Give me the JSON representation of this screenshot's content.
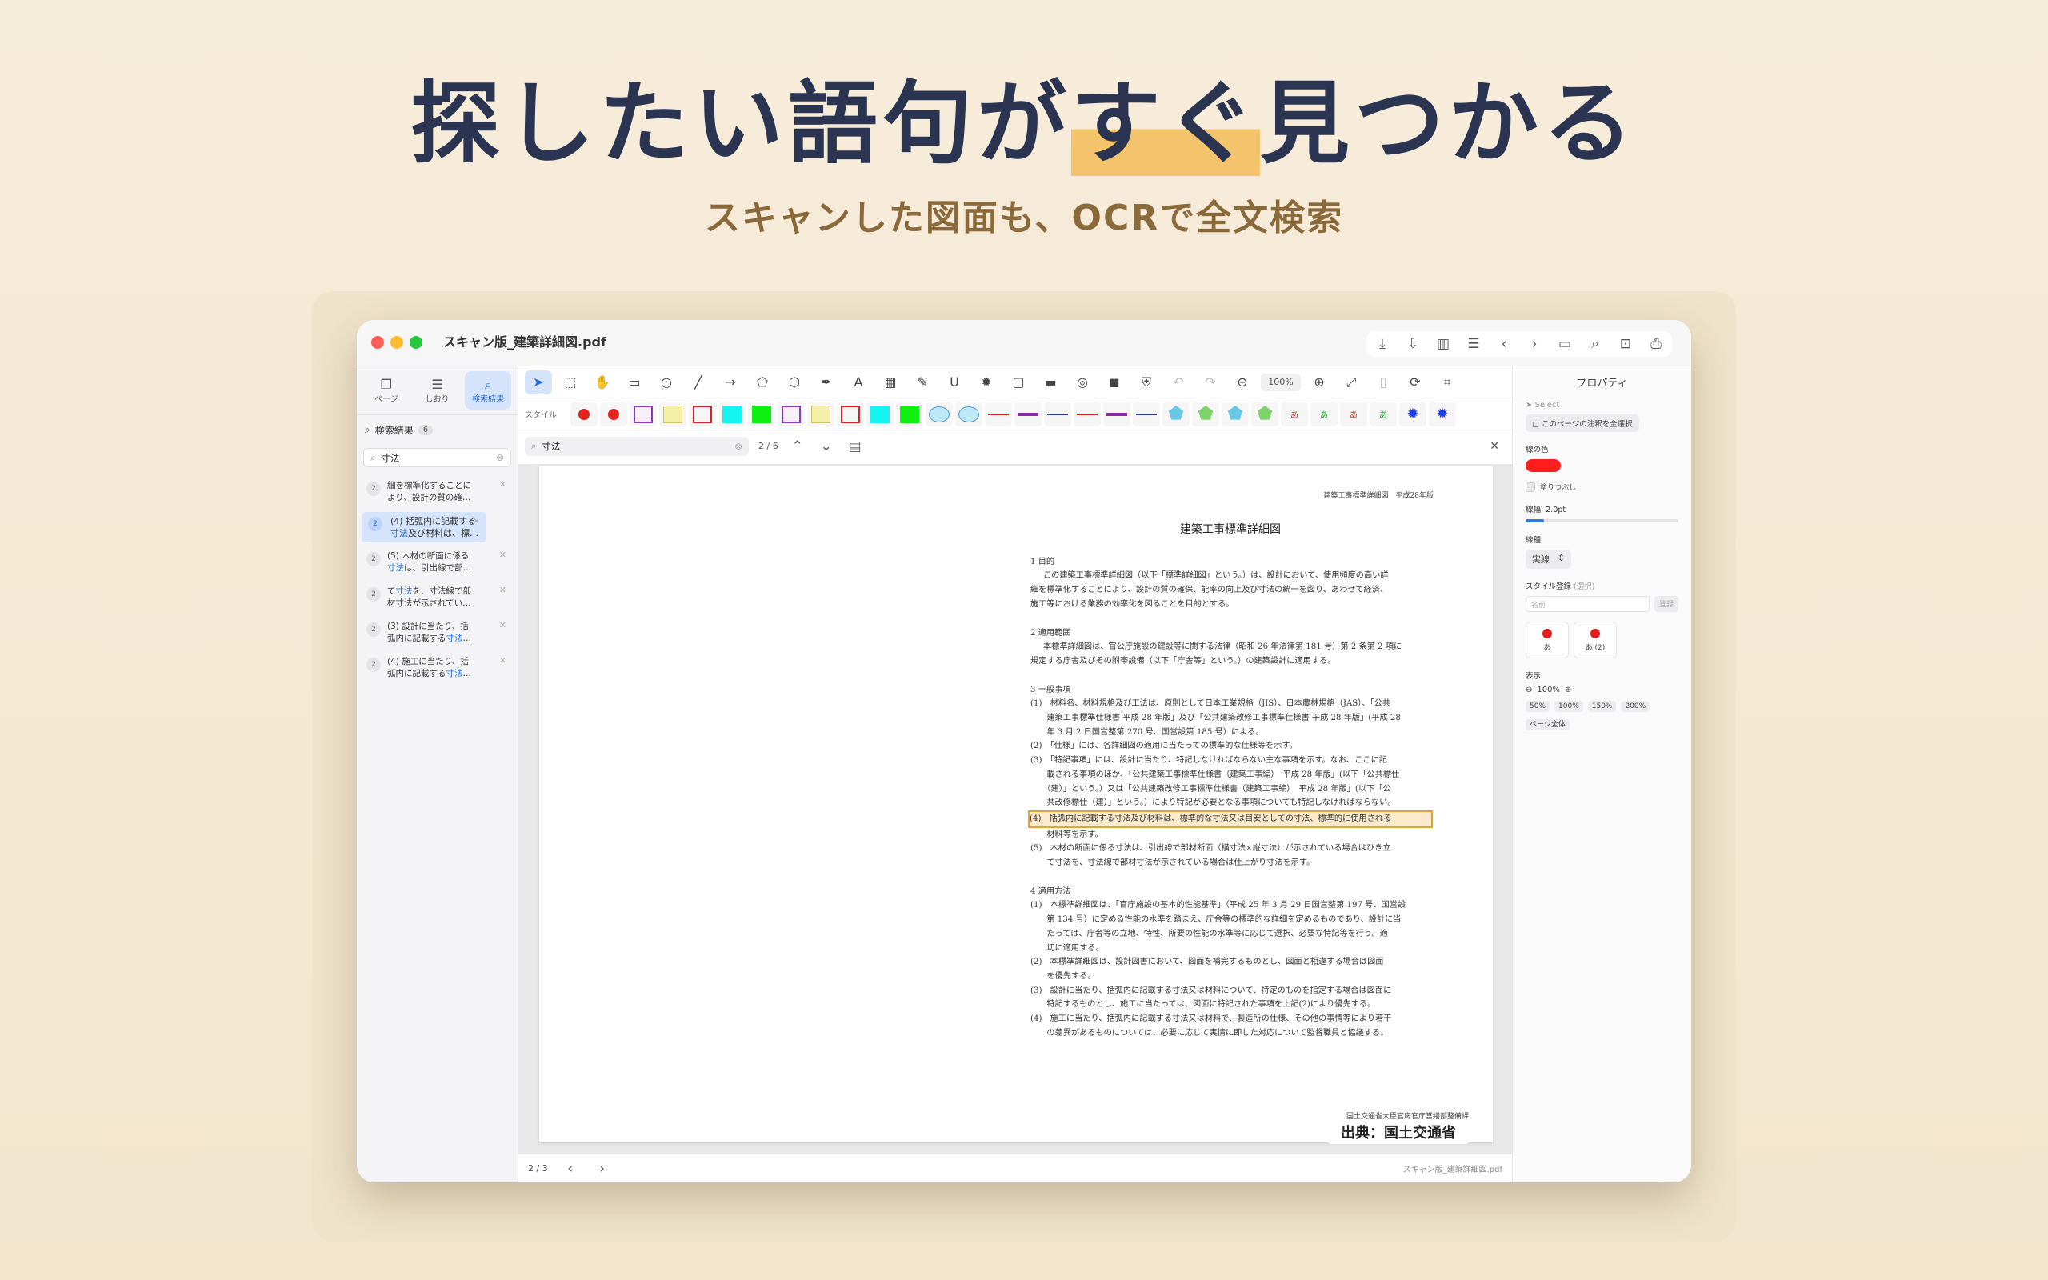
{
  "hero": {
    "title_pre": "探したい語句が",
    "title_highlight": "すぐ",
    "title_post": "見つかる",
    "subtitle": "スキャンした図面も、OCRで全文検索"
  },
  "window": {
    "title": "スキャン版_建築詳細図.pdf"
  },
  "sidebar": {
    "tabs": [
      {
        "label": "ページ"
      },
      {
        "label": "しおり"
      },
      {
        "label": "検索結果"
      }
    ],
    "results_label": "検索結果",
    "results_count": "6",
    "search_value": "寸法",
    "results": [
      {
        "page": "2",
        "line1": "細を標準化することに",
        "line2": "より、設計の質の確…"
      },
      {
        "page": "2",
        "line1": "(4) 括弧内に記載する",
        "hit": "寸法",
        "line2rest": "及び材料は、標…"
      },
      {
        "page": "2",
        "line1": "(5) 木材の断面に係る",
        "hit": "寸法",
        "line2rest": "は、引出線で部…"
      },
      {
        "page": "2",
        "line1pre": "て",
        "hit": "寸法",
        "line1post": "を、寸法線で部",
        "line2": "材寸法が示されてい…"
      },
      {
        "page": "2",
        "line1": "(3) 設計に当たり、括",
        "line2pre": "弧内に記載する",
        "hit": "寸法",
        "line2post": "…"
      },
      {
        "page": "2",
        "line1": "(4) 施工に当たり、括",
        "line2pre": "弧内に記載する",
        "hit": "寸法",
        "line2post": "…"
      }
    ]
  },
  "toolbar": {
    "zoom": "100%",
    "style_label": "スタイル"
  },
  "findbar": {
    "value": "寸法",
    "count": "2 / 6"
  },
  "document": {
    "header": "建築工事標準詳細図　平成28年版",
    "title": "建築工事標準詳細図",
    "s1": "1  目的",
    "s1_p": [
      "この建築工事標準詳細図（以下「標準詳細図」という。）は、設計において、使用頻度の高い詳",
      "細を標準化することにより、設計の質の確保、能率の向上及び寸法の統一を図り、あわせて経済、",
      "施工等における業務の効率化を図ることを目的とする。"
    ],
    "s2": "2  適用範囲",
    "s2_p": [
      "本標準詳細図は、官公庁施設の建設等に関する法律（昭和 26 年法律第 181 号）第 2 条第 2 項に",
      "規定する庁舎及びその附帯設備（以下「庁舎等」という。）の建築設計に適用する。"
    ],
    "s3": "3  一般事項",
    "s3_p": [
      "(1)　材料名、材料規格及び工法は、原則として日本工業規格（JIS）、日本農林規格（JAS）、「公共",
      "　　建築工事標準仕様書 平成 28 年版」及び「公共建築改修工事標準仕様書 平成 28 年版」(平成 28",
      "　　年 3 月 2 日国営整第 270 号、国営設第 185 号）による。",
      "(2)　「仕様」には、各詳細図の適用に当たっての標準的な仕様等を示す。",
      "(3)　「特記事項」には、設計に当たり、特記しなければならない主な事項を示す。なお、ここに記",
      "　　載される事項のほか、「公共建築工事標準仕様書（建築工事編）　平成 28 年版」(以下「公共標仕",
      "　　（建）」という。）又は「公共建築改修工事標準仕様書（建築工事編）　平成 28 年版」(以下「公",
      "　　共改修標仕（建）」という。）により特記が必要となる事項についても特記しなければならない。"
    ],
    "s3_hit": "(4)　括弧内に記載する寸法及び材料は、標準的な寸法又は目安としての寸法、標準的に使用される",
    "s3_p2": [
      "　　材料等を示す。",
      "(5)　木材の断面に係る寸法は、引出線で部材断面（横寸法×縦寸法）が示されている場合はひき立",
      "　　て寸法を、寸法線で部材寸法が示されている場合は仕上がり寸法を示す。"
    ],
    "s4": "4  適用方法",
    "s4_p": [
      "(1)　本標準詳細図は、「官庁施設の基本的性能基準」（平成 25 年 3 月 29 日国営整第 197 号、国営設",
      "　　第 134 号）に定める性能の水準を踏まえ、庁舎等の標準的な詳細を定めるものであり、設計に当",
      "　　たっては、庁舎等の立地、特性、所要の性能の水準等に応じて選択、必要な特記等を行う。適",
      "　　切に適用する。",
      "(2)　本標準詳細図は、設計図書において、図面を補完するものとし、図面と相違する場合は図面",
      "　　を優先する。",
      "(3)　設計に当たり、括弧内に記載する寸法又は材料について、特定のものを指定する場合は図面に",
      "　　特記するものとし、施工に当たっては、図面に特記された事項を上記(2)により優先する。",
      "(4)　施工に当たり、括弧内に記載する寸法又は材料で、製造所の仕様、その他の事情等により若干",
      "　　の差異があるものについては、必要に応じて実情に即した対応について監督職員と協議する。"
    ],
    "footer": "国土交通省大臣官房官庁営繕部整備課",
    "source": "出典：国土交通省"
  },
  "status": {
    "page": "2 / 3",
    "filename": "スキャン版_建築詳細図.pdf"
  },
  "properties": {
    "title": "プロパティ",
    "select": "Select",
    "select_all": "このページの注釈を全選択",
    "line_color": "線の色",
    "line_color_value": "#ff1d1d",
    "fill": "塗りつぶし",
    "width": "線幅: 2.0pt",
    "width_value": 0.12,
    "dash": "線種",
    "dash_value": "実線",
    "style_reg": "スタイル登録",
    "style_reg_sub": "(選択)",
    "name_placeholder": "名前",
    "register": "登録",
    "cards": [
      "あ",
      "あ (2)"
    ],
    "display": "表示",
    "zoom": "100%",
    "zoom_presets": [
      "50%",
      "100%",
      "150%",
      "200%"
    ],
    "fit_page": "ページ全体"
  },
  "colors": {
    "accent": "#2a6ad6",
    "highlight": "#f3c46c",
    "hero": "#2b3552"
  }
}
